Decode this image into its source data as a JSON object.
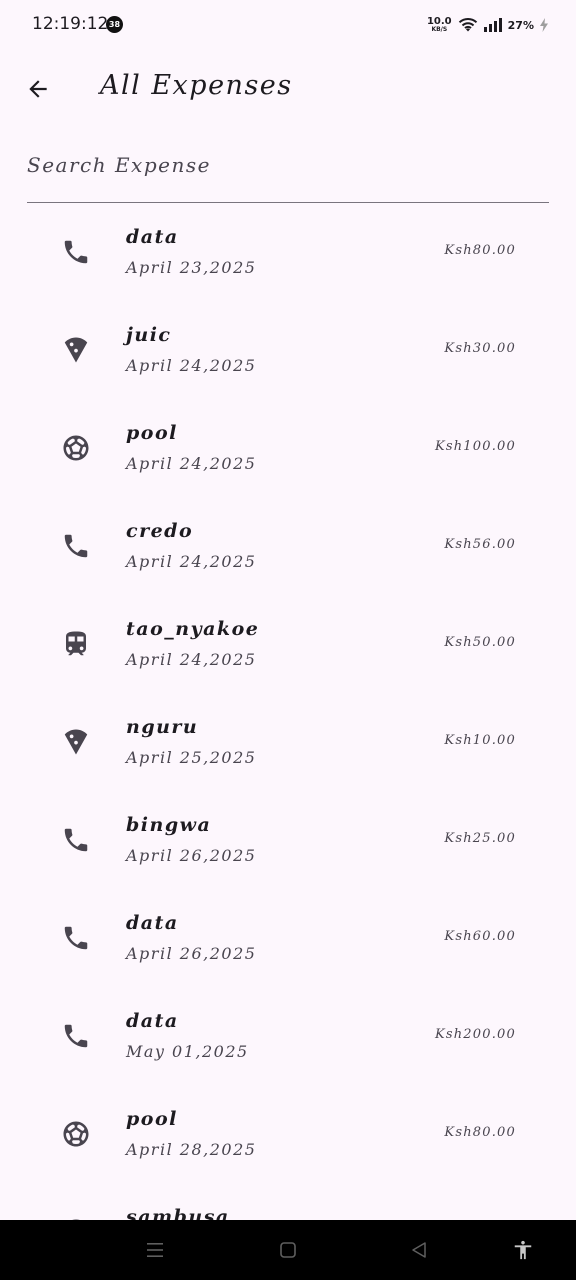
{
  "status_bar": {
    "time": "12:19:12",
    "notification_count": "38",
    "net_speed_value": "10.0",
    "net_speed_unit": "KB/S",
    "battery": "27%"
  },
  "app_bar": {
    "title": "All Expenses",
    "back_icon": "arrow-left-icon"
  },
  "search": {
    "placeholder": "Search Expense",
    "value": ""
  },
  "expenses": [
    {
      "name": "data",
      "date": "April 23,2025",
      "amount": "Ksh80.00",
      "icon": "phone-icon"
    },
    {
      "name": "juic",
      "date": "April 24,2025",
      "amount": "Ksh30.00",
      "icon": "pizza-icon"
    },
    {
      "name": "pool",
      "date": "April 24,2025",
      "amount": "Ksh100.00",
      "icon": "soccer-ball-icon"
    },
    {
      "name": "credo",
      "date": "April 24,2025",
      "amount": "Ksh56.00",
      "icon": "phone-icon"
    },
    {
      "name": "tao_nyakoe",
      "date": "April 24,2025",
      "amount": "Ksh50.00",
      "icon": "train-icon"
    },
    {
      "name": "nguru",
      "date": "April 25,2025",
      "amount": "Ksh10.00",
      "icon": "pizza-icon"
    },
    {
      "name": "bingwa",
      "date": "April 26,2025",
      "amount": "Ksh25.00",
      "icon": "phone-icon"
    },
    {
      "name": "data",
      "date": "April 26,2025",
      "amount": "Ksh60.00",
      "icon": "phone-icon"
    },
    {
      "name": "data",
      "date": "May 01,2025",
      "amount": "Ksh200.00",
      "icon": "phone-icon"
    },
    {
      "name": "pool",
      "date": "April 28,2025",
      "amount": "Ksh80.00",
      "icon": "soccer-ball-icon"
    },
    {
      "name": "sambusa",
      "date": "",
      "amount": "",
      "icon": "pizza-icon"
    }
  ],
  "nav_bar": {
    "menu_icon": "menu-icon",
    "home_icon": "home-square-icon",
    "back_icon": "back-triangle-icon",
    "accessibility_icon": "accessibility-icon"
  },
  "colors": {
    "background": "#fdf7fd",
    "text_primary": "#1d1b20",
    "text_secondary": "#49454f",
    "icon": "#49454f",
    "divider": "#79747e",
    "nav_background": "#000000"
  }
}
